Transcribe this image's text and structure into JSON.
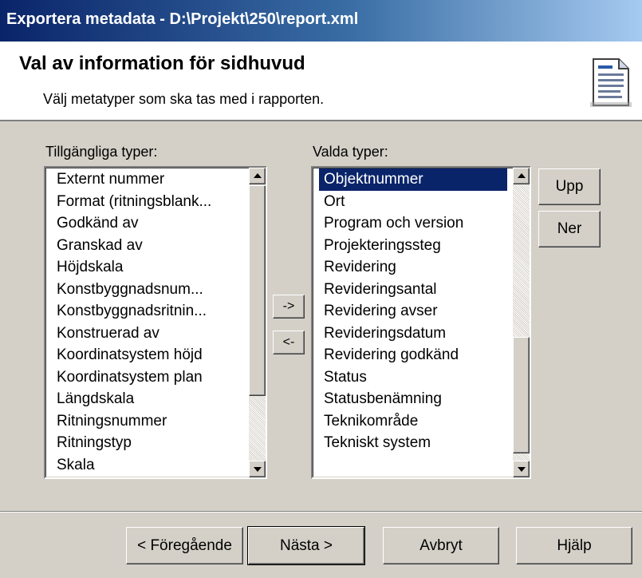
{
  "window": {
    "title": "Exportera metadata - D:\\Projekt\\250\\report.xml"
  },
  "header": {
    "title": "Val av information för sidhuvud",
    "subtitle": "Välj metatyper som ska tas med i rapporten.",
    "icon": "document-icon"
  },
  "available": {
    "label": "Tillgängliga typer:",
    "items": [
      "Externt nummer",
      "Format (ritningsblank...",
      "Godkänd av",
      "Granskad av",
      "Höjdskala",
      "Konstbyggnadsnum...",
      "Konstbyggnadsritnin...",
      "Konstruerad av",
      "Koordinatsystem höjd",
      "Koordinatsystem plan",
      "Längdskala",
      "Ritningsnummer",
      "Ritningstyp",
      "Skala"
    ]
  },
  "selected": {
    "label": "Valda typer:",
    "selected_index": 0,
    "items": [
      "Objektnummer",
      "Ort",
      "Program och version",
      "Projekteringssteg",
      "Revidering",
      "Revideringsantal",
      "Revidering avser",
      "Revideringsdatum",
      "Revidering godkänd",
      "Status",
      "Statusbenämning",
      "Teknikområde",
      "Tekniskt system"
    ]
  },
  "move": {
    "add_label": "->",
    "remove_label": "<-"
  },
  "order": {
    "up_label": "Upp",
    "down_label": "Ner"
  },
  "footer": {
    "back_label": "< Föregående",
    "next_label": "Nästa >",
    "cancel_label": "Avbryt",
    "help_label": "Hjälp"
  },
  "colors": {
    "titlebar_start": "#0a246a",
    "selection": "#0a246a",
    "face": "#d4d0c8"
  }
}
